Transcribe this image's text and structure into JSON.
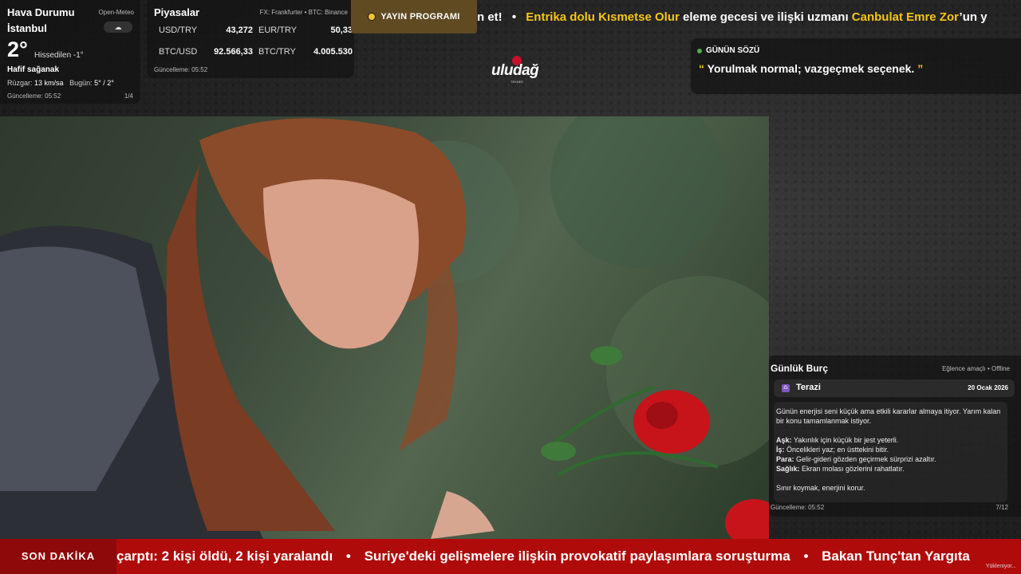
{
  "weather": {
    "title": "Hava Durumu",
    "source": "Open-Meteo",
    "city": "İstanbul",
    "icon": "cloud-rain-icon",
    "temperature": "2°",
    "feels_like": "Hissedilen -1°",
    "condition": "Hafif sağanak",
    "wind_label": "Rüzgar:",
    "wind_value": "13 km/sa",
    "today_label": "Bugün:",
    "today_value": "5° / 2°",
    "updated": "Güncelleme: 05:52",
    "page": "1/4"
  },
  "markets": {
    "title": "Piyasalar",
    "source": "FX: Frankfurter • BTC: Binance",
    "rates": [
      {
        "label": "USD/TRY",
        "value": "43,272"
      },
      {
        "label": "EUR/TRY",
        "value": "50,33"
      },
      {
        "label": "BTC/USD",
        "value": "92.566,33"
      },
      {
        "label": "BTC/TRY",
        "value": "4.005.530"
      }
    ],
    "updated": "Güncelleme: 05:52"
  },
  "schedule": {
    "label": "YAYIN PROGRAMI"
  },
  "top_ticker": {
    "lead": "n et!",
    "sep": "•",
    "part1": "Entrika dolu Kısmetse Olur",
    "part2": "eleme gecesi ve ilişki uzmanı",
    "part3": "Canbulat Emre Zor",
    "part4": "’un y"
  },
  "logo": {
    "text": "uludağ",
    "sub": "TEKNEE"
  },
  "quote": {
    "label": "GÜNÜN SÖZÜ",
    "open_mark": "“",
    "text": "Yorulmak normal; vazgeçmek seçenek.",
    "close_mark": "”"
  },
  "horoscope": {
    "title": "Günlük Burç",
    "note": "Eğlence amaçlı • Offline",
    "sign_symbol": "♎",
    "sign": "Terazi",
    "date": "20 Ocak 2026",
    "intro": "Günün enerjisi seni küçük ama etkili kararlar almaya itiyor. Yarım kalan bir konu tamamlanmak istiyor.",
    "items": [
      {
        "key": "Aşk:",
        "text": "Yakınlık için küçük bir jest yeterli."
      },
      {
        "key": "İş:",
        "text": "Öncelikleri yaz; en üsttekini bitir."
      },
      {
        "key": "Para:",
        "text": "Gelir-gideri gözden geçirmek sürprizi azaltır."
      },
      {
        "key": "Sağlık:",
        "text": "Ekran molası gözlerini rahatlatır."
      }
    ],
    "closing": "Sınır koymak, enerjini korur.",
    "updated": "Güncelleme: 05:52",
    "page": "7/12"
  },
  "breaking": {
    "label": "SON DAKİKA",
    "items": [
      "çarptı: 2 kişi öldü, 2 kişi yaralandı",
      "Suriye'deki gelişmelere ilişkin provokatif paylaşımlara soruşturma",
      "Bakan Tunç'tan Yargıta"
    ],
    "sep": "•",
    "loading": "Yükleniyor..."
  },
  "colors": {
    "accent_yellow": "#f5c518",
    "breaking_red": "#b00b0b",
    "quote_dot": "#4caf50"
  }
}
